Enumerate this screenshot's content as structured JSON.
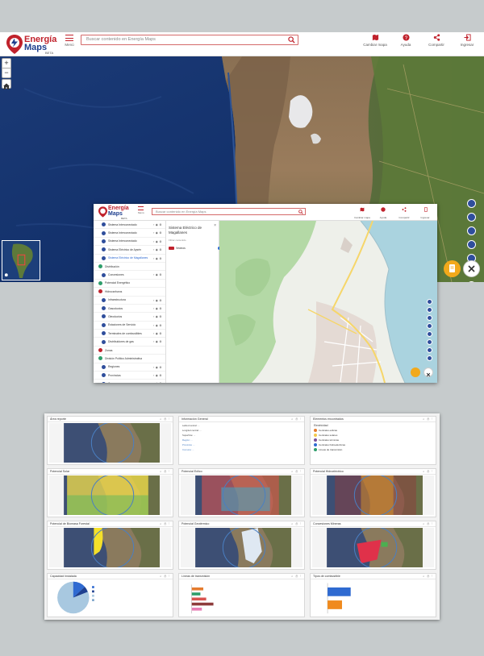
{
  "app": {
    "logo_line1": "Energía",
    "logo_line2": "Maps",
    "logo_beta": "BETA",
    "menu_label": "Menú",
    "search_placeholder": "Buscar contenido en Energía Maps",
    "toolbar": [
      {
        "icon": "map-change-icon",
        "label": "Cambiar mapa"
      },
      {
        "icon": "help-icon",
        "label": "Ayuda"
      },
      {
        "icon": "share-icon",
        "label": "Compartir"
      },
      {
        "icon": "login-icon",
        "label": "Ingresar"
      }
    ],
    "zoom_in": "+",
    "zoom_out": "−"
  },
  "secondary": {
    "logo_line1": "Energía",
    "logo_line2": "Maps",
    "logo_beta": "BETA",
    "menu_label": "Menú",
    "search_placeholder": "Buscar contenido en Energía Maps",
    "toolbar": [
      "Cambiar mapa",
      "Ayuda",
      "Compartir",
      "Ingresar"
    ],
    "sidebar": [
      {
        "label": "Sistema Interconectado",
        "type": "layer"
      },
      {
        "label": "Sistema Interconectado",
        "type": "layer"
      },
      {
        "label": "Sistema Interconectado",
        "type": "layer"
      },
      {
        "label": "Sistema Eléctrico de Aysén",
        "type": "layer"
      },
      {
        "label": "Sistema Eléctrico de Magallanes",
        "type": "layer",
        "active": true
      },
      {
        "label": "Distribución",
        "type": "cat"
      },
      {
        "label": "Concesiones",
        "type": "layer"
      },
      {
        "label": "Potencial Energético",
        "type": "cat"
      },
      {
        "label": "Hidrocarburos",
        "type": "red"
      },
      {
        "label": "Infraestructura",
        "type": "layer"
      },
      {
        "label": "Gasoductos",
        "type": "layer"
      },
      {
        "label": "Oleoductos",
        "type": "layer"
      },
      {
        "label": "Estaciones de Servicio",
        "type": "layer"
      },
      {
        "label": "Terminales de combustibles",
        "type": "layer"
      },
      {
        "label": "Distribuidores de gas",
        "type": "layer"
      },
      {
        "label": "Zonas",
        "type": "red"
      },
      {
        "label": "División Político Administrativa",
        "type": "cat"
      },
      {
        "label": "Regiones",
        "type": "layer"
      },
      {
        "label": "Provincias",
        "type": "layer"
      },
      {
        "label": "Comunas",
        "type": "layer"
      }
    ],
    "layer_panel": {
      "title": "Sistema Eléctrico de Magallanes",
      "subtitle": "Filtrar contenido",
      "item": "Vecinos"
    }
  },
  "dashboard": {
    "panels": [
      {
        "title": "Área reporte",
        "kind": "map"
      },
      {
        "title": "Información General",
        "kind": "info"
      },
      {
        "title": "Elementos encontrados",
        "kind": "legend"
      },
      {
        "title": "Potencial Solar",
        "kind": "solar"
      },
      {
        "title": "Potencial Eólico",
        "kind": "wind"
      },
      {
        "title": "Potencial Hidroeléctrico",
        "kind": "hydro"
      },
      {
        "title": "Potencial de Biomasa Forestal",
        "kind": "biomass"
      },
      {
        "title": "Potencial Geotérmico",
        "kind": "geo"
      },
      {
        "title": "Concesiones Mineras",
        "kind": "mining"
      },
      {
        "title": "Capacidad Instalada",
        "kind": "pie"
      },
      {
        "title": "Líneas de transmisión",
        "kind": "bars1"
      },
      {
        "title": "Tipos de combustible",
        "kind": "bars2"
      }
    ],
    "info_lines": [
      "Latitud central: ...",
      "Longitud central: ...",
      "Superficie: ...",
      "Región: ...",
      "Provincia: ...",
      "Comuna: ..."
    ],
    "legend_heading": "Electricidad",
    "legend_items": [
      "Centrales eólicas",
      "Centrales solares",
      "Centrales térmicas",
      "Centrales hidroeléctricas",
      "Líneas de transmisión"
    ]
  },
  "colors": {
    "brand_red": "#c0222c",
    "brand_blue": "#1e3f8f",
    "tool_blue": "#2f4e9c",
    "fab_orange": "#f2a91b",
    "fab_close": "#ffffff"
  }
}
